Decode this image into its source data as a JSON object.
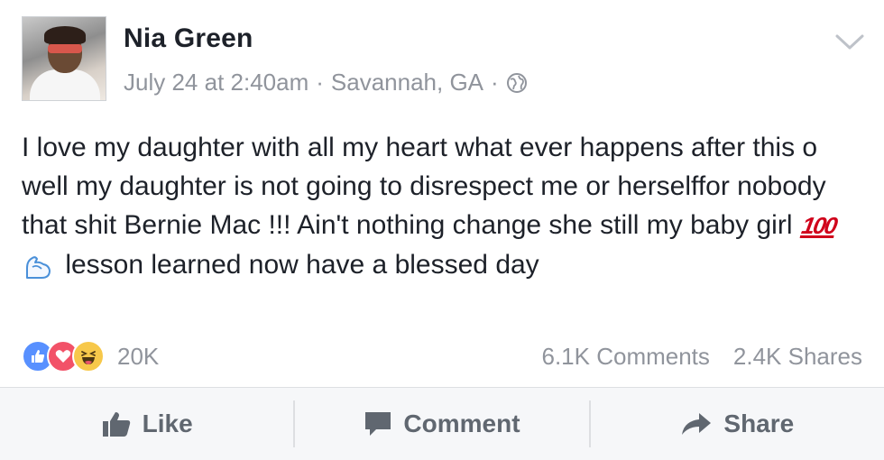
{
  "post": {
    "author": "Nia Green",
    "date": "July 24 at 2:40am",
    "separator": "·",
    "location": "Savannah, GA",
    "privacy_icon": "globe-icon",
    "text_before_emoji": "I love my daughter with all my heart what ever happens after this o well my daughter is not going to disrespect me or herselffor nobody that shit Bernie Mac !!! Ain't nothing change she still my baby girl ",
    "emoji_100": "100",
    "emoji_muscle": "flexed-biceps",
    "text_after_emoji": " lesson learned now have a blessed day"
  },
  "engagement": {
    "reactions": [
      "like",
      "love",
      "haha"
    ],
    "reaction_count": "20K",
    "comments": "6.1K Comments",
    "shares": "2.4K Shares"
  },
  "actions": {
    "like": "Like",
    "comment": "Comment",
    "share": "Share"
  },
  "colors": {
    "like_blue": "#5890ff",
    "love_red": "#f25268",
    "haha_yellow": "#f7c84a",
    "muted_text": "#90949c",
    "action_text": "#606770"
  }
}
